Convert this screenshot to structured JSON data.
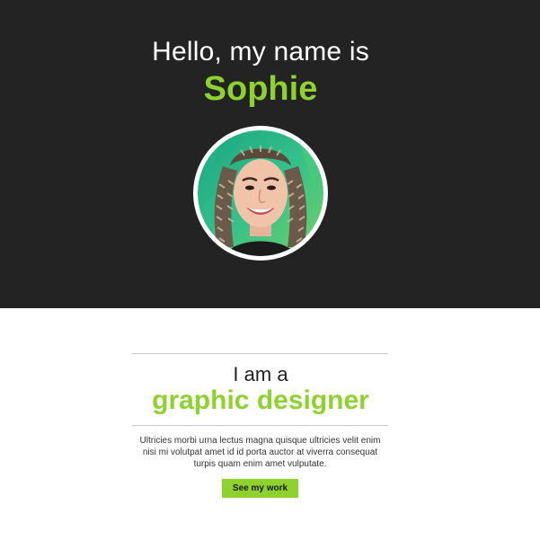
{
  "hero": {
    "greeting": "Hello, my name is",
    "name": "Sophie",
    "photo_alt": "Portrait of Sophie"
  },
  "intro": {
    "lead": "I am a",
    "role": "graphic designer",
    "body": "Ultricies morbi urna lectus magna quisque ultricies velit enim nisi mi volutpat amet id id porta auctor at viverra consequat turpis quam enim amet vulputate.",
    "cta_label": "See my work"
  },
  "colors": {
    "hero_background": "#232323",
    "accent": "#8ed22e",
    "divider": "#c9c9c9"
  }
}
